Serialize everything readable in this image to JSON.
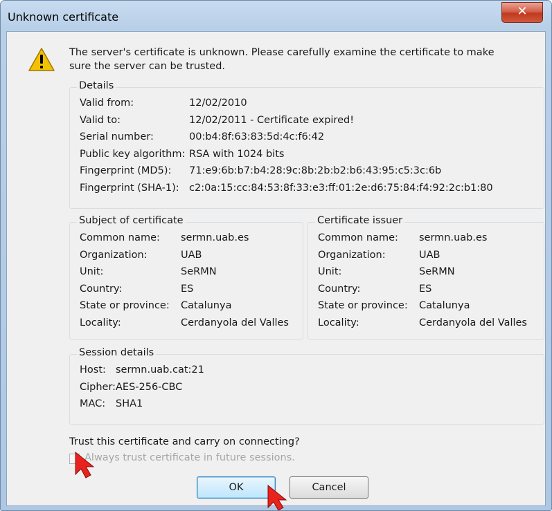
{
  "window": {
    "title": "Unknown certificate",
    "close_glyph": "✕"
  },
  "intro": "The server's certificate is unknown. Please carefully examine the certificate to make sure the server can be trusted.",
  "details": {
    "title": "Details",
    "rows": [
      {
        "label": "Valid from:",
        "value": "12/02/2010"
      },
      {
        "label": "Valid to:",
        "value": "12/02/2011 - Certificate expired!"
      },
      {
        "label": "Serial number:",
        "value": "00:b4:8f:63:83:5d:4c:f6:42"
      },
      {
        "label": "Public key algorithm:",
        "value": "RSA with 1024 bits"
      },
      {
        "label": "Fingerprint (MD5):",
        "value": "71:e9:6b:b7:b4:28:9c:8b:2b:b2:b6:43:95:c5:3c:6b"
      },
      {
        "label": "Fingerprint (SHA-1):",
        "value": "c2:0a:15:cc:84:53:8f:33:e3:ff:01:2e:d6:75:84:f4:92:2c:b1:80"
      }
    ]
  },
  "subject": {
    "title": "Subject of certificate",
    "rows": [
      {
        "label": "Common name:",
        "value": "sermn.uab.es"
      },
      {
        "label": "Organization:",
        "value": "UAB"
      },
      {
        "label": "Unit:",
        "value": "SeRMN"
      },
      {
        "label": "Country:",
        "value": "ES"
      },
      {
        "label": "State or province:",
        "value": "Catalunya"
      },
      {
        "label": "Locality:",
        "value": "Cerdanyola del Valles"
      }
    ]
  },
  "issuer": {
    "title": "Certificate issuer",
    "rows": [
      {
        "label": "Common name:",
        "value": "sermn.uab.es"
      },
      {
        "label": "Organization:",
        "value": "UAB"
      },
      {
        "label": "Unit:",
        "value": "SeRMN"
      },
      {
        "label": "Country:",
        "value": "ES"
      },
      {
        "label": "State or province:",
        "value": "Catalunya"
      },
      {
        "label": "Locality:",
        "value": "Cerdanyola del Valles"
      }
    ]
  },
  "session": {
    "title": "Session details",
    "rows": [
      {
        "label": "Host:",
        "value": "sermn.uab.cat:21"
      },
      {
        "label": "Cipher:",
        "value": "AES-256-CBC"
      },
      {
        "label": "MAC:",
        "value": "SHA1"
      }
    ]
  },
  "trust_question": "Trust this certificate and carry on connecting?",
  "always_trust": {
    "label": "Always trust certificate in future sessions.",
    "checked": false
  },
  "buttons": {
    "ok": "OK",
    "cancel": "Cancel"
  },
  "colors": {
    "arrow": "#e8231e",
    "warning": "#f2c200"
  }
}
